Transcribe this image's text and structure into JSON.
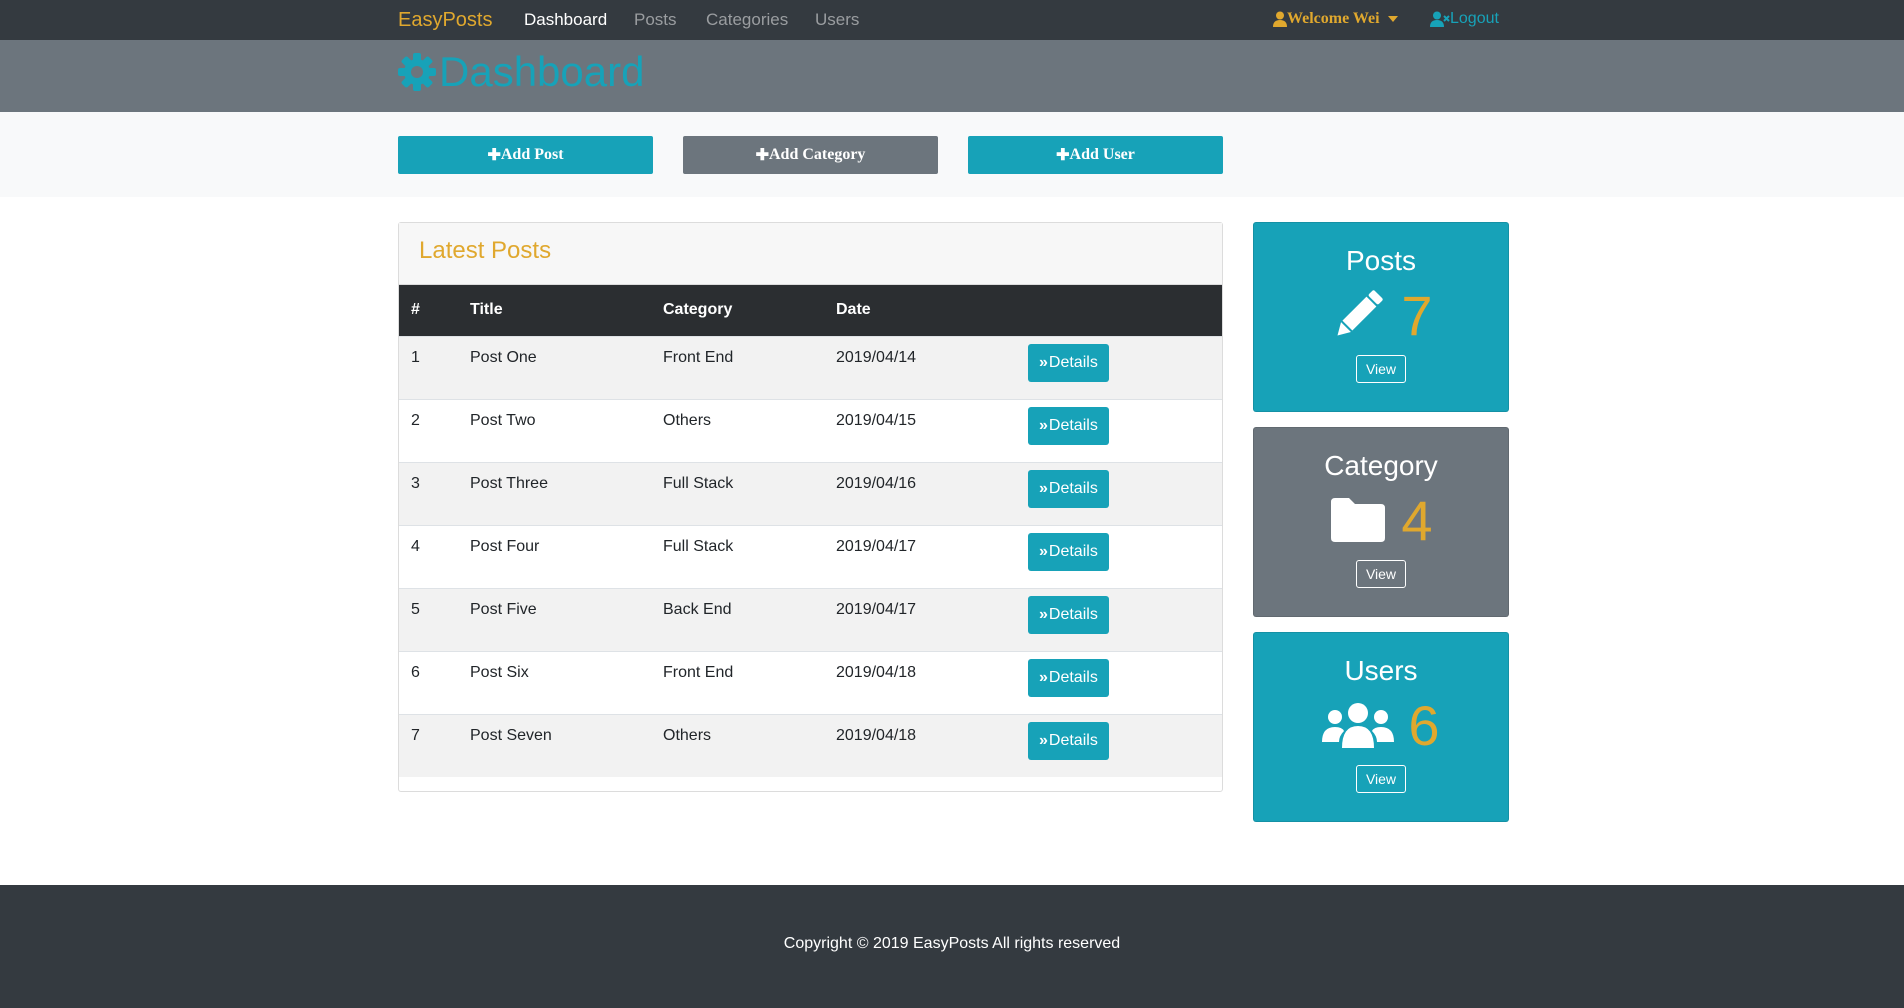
{
  "navbar": {
    "brand": "EasyPosts",
    "links": [
      "Dashboard",
      "Posts",
      "Categories",
      "Users"
    ],
    "welcome": "Welcome Wei",
    "logout": "Logout"
  },
  "header": {
    "title": "Dashboard"
  },
  "actions": {
    "add_post": "Add Post",
    "add_category": "Add Category",
    "add_user": "Add User"
  },
  "latest": {
    "title": "Latest Posts",
    "columns": [
      "#",
      "Title",
      "Category",
      "Date"
    ],
    "details_label": "Details",
    "rows": [
      [
        "1",
        "Post One",
        "Front End",
        "2019/04/14"
      ],
      [
        "2",
        "Post Two",
        "Others",
        "2019/04/15"
      ],
      [
        "3",
        "Post Three",
        "Full Stack",
        "2019/04/16"
      ],
      [
        "4",
        "Post Four",
        "Full Stack",
        "2019/04/17"
      ],
      [
        "5",
        "Post Five",
        "Back End",
        "2019/04/17"
      ],
      [
        "6",
        "Post Six",
        "Front End",
        "2019/04/18"
      ],
      [
        "7",
        "Post Seven",
        "Others",
        "2019/04/18"
      ]
    ]
  },
  "stats": [
    {
      "title": "Posts",
      "count": "7",
      "view": "View",
      "icon": "pencil-icon",
      "color": "#17a2b8"
    },
    {
      "title": "Category",
      "count": "4",
      "view": "View",
      "icon": "folder-icon",
      "color": "#6c757d"
    },
    {
      "title": "Users",
      "count": "6",
      "view": "View",
      "icon": "users-icon",
      "color": "#17a2b8"
    }
  ],
  "footer": {
    "text": "Copyright © 2019 EasyPosts All rights reserved"
  },
  "colors": {
    "navbar": "#343a40",
    "accent": "#e0a82e",
    "info": "#17a2b8",
    "secondary": "#6c757d"
  }
}
